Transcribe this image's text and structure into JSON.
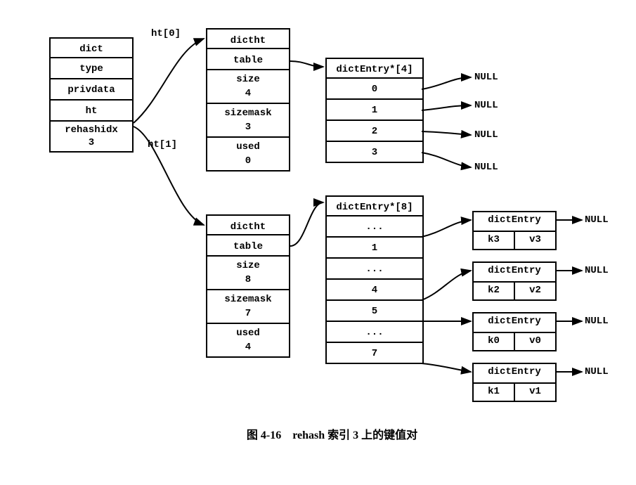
{
  "dict": {
    "title": "dict",
    "fields": [
      "type",
      "privdata",
      "ht",
      "rehashidx\n3"
    ]
  },
  "ht_labels": {
    "ht0": "ht[0]",
    "ht1": "ht[1]"
  },
  "ht0": {
    "title": "dictht",
    "table": "table",
    "size_label": "size",
    "size_val": "4",
    "sizemask_label": "sizemask",
    "sizemask_val": "3",
    "used_label": "used",
    "used_val": "0"
  },
  "ht1": {
    "title": "dictht",
    "table": "table",
    "size_label": "size",
    "size_val": "8",
    "sizemask_label": "sizemask",
    "sizemask_val": "7",
    "used_label": "used",
    "used_val": "4"
  },
  "arr4": {
    "header": "dictEntry*[4]",
    "rows": [
      "0",
      "1",
      "2",
      "3"
    ]
  },
  "arr8": {
    "header": "dictEntry*[8]",
    "rows": [
      "...",
      "1",
      "...",
      "4",
      "5",
      "...",
      "7"
    ]
  },
  "entries": [
    {
      "title": "dictEntry",
      "k": "k3",
      "v": "v3"
    },
    {
      "title": "dictEntry",
      "k": "k2",
      "v": "v2"
    },
    {
      "title": "dictEntry",
      "k": "k0",
      "v": "v0"
    },
    {
      "title": "dictEntry",
      "k": "k1",
      "v": "v1"
    }
  ],
  "null": "NULL",
  "caption": "图 4-16　rehash 索引 3 上的键值对"
}
